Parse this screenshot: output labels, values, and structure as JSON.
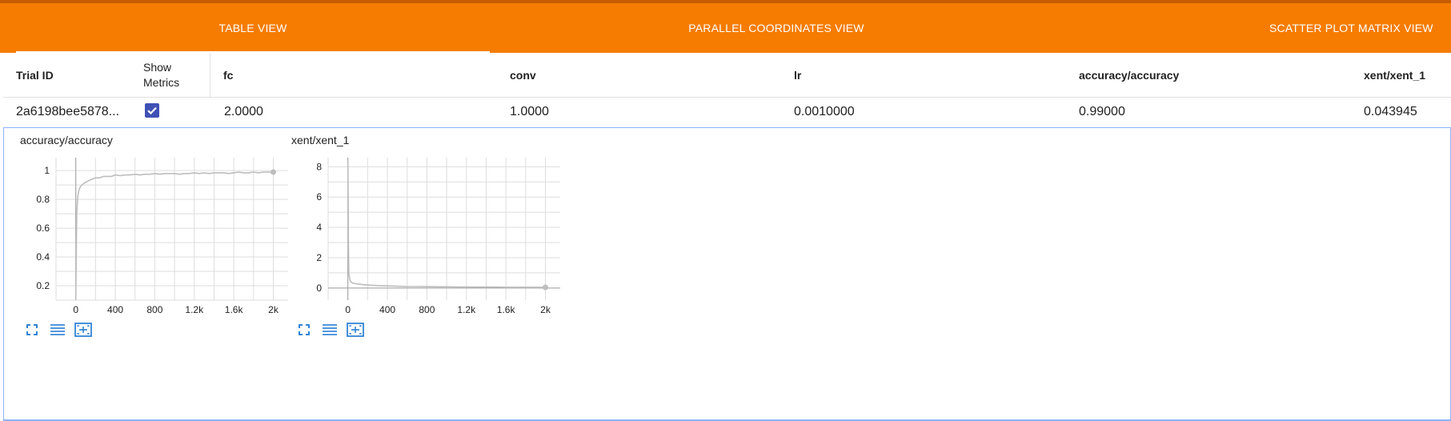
{
  "tabs": [
    {
      "label": "TABLE VIEW",
      "active": true
    },
    {
      "label": "PARALLEL COORDINATES VIEW",
      "active": false
    },
    {
      "label": "SCATTER PLOT MATRIX VIEW",
      "active": false
    }
  ],
  "table": {
    "headers": {
      "trial_id": "Trial ID",
      "show_metrics_1": "Show",
      "show_metrics_2": "Metrics",
      "fc": "fc",
      "conv": "conv",
      "lr": "lr",
      "accuracy": "accuracy/accuracy",
      "xent": "xent/xent_1"
    },
    "row": {
      "trial_id": "2a6198bee5878...",
      "show_metrics": true,
      "fc": "2.0000",
      "conv": "1.0000",
      "lr": "0.0010000",
      "accuracy": "0.99000",
      "xent": "0.043945"
    }
  },
  "accent_color": "#f57c00",
  "checkbox_color": "#3f51b5",
  "tool_icons": [
    "fullscreen-icon",
    "toggle-y-log-icon",
    "fit-domain-icon"
  ],
  "chart_data": [
    {
      "type": "line",
      "title": "accuracy/accuracy",
      "xlim": [
        -200,
        2150
      ],
      "ylim": [
        0.1,
        1.09
      ],
      "x_ticks": [
        "0",
        "400",
        "800",
        "1.2k",
        "1.6k",
        "2k"
      ],
      "x_tick_values": [
        0,
        400,
        800,
        1200,
        1600,
        2000
      ],
      "y_ticks": [
        "0.2",
        "0.4",
        "0.6",
        "0.8",
        "1"
      ],
      "y_tick_values": [
        0.2,
        0.4,
        0.6,
        0.8,
        1.0
      ],
      "series": [
        {
          "x": [
            0,
            5,
            10,
            20,
            30,
            40,
            60,
            80,
            100,
            130,
            160,
            200,
            240,
            280,
            320,
            360,
            400,
            450,
            500,
            550,
            600,
            650,
            700,
            750,
            800,
            850,
            900,
            950,
            1000,
            1050,
            1100,
            1150,
            1200,
            1250,
            1300,
            1350,
            1400,
            1450,
            1500,
            1550,
            1600,
            1650,
            1700,
            1750,
            1800,
            1850,
            1900,
            1950,
            2000
          ],
          "y": [
            0.1,
            0.45,
            0.7,
            0.82,
            0.86,
            0.88,
            0.9,
            0.91,
            0.92,
            0.93,
            0.94,
            0.95,
            0.95,
            0.96,
            0.96,
            0.96,
            0.97,
            0.965,
            0.97,
            0.97,
            0.975,
            0.97,
            0.975,
            0.975,
            0.98,
            0.975,
            0.98,
            0.98,
            0.98,
            0.975,
            0.98,
            0.98,
            0.985,
            0.98,
            0.985,
            0.98,
            0.985,
            0.985,
            0.985,
            0.98,
            0.985,
            0.99,
            0.985,
            0.985,
            0.99,
            0.985,
            0.99,
            0.99,
            0.99
          ]
        }
      ]
    },
    {
      "type": "line",
      "title": "xent/xent_1",
      "xlim": [
        -200,
        2150
      ],
      "ylim": [
        -0.8,
        8.6
      ],
      "x_ticks": [
        "0",
        "400",
        "800",
        "1.2k",
        "1.6k",
        "2k"
      ],
      "x_tick_values": [
        0,
        400,
        800,
        1200,
        1600,
        2000
      ],
      "y_ticks": [
        "0",
        "2",
        "4",
        "6",
        "8"
      ],
      "y_tick_values": [
        0,
        2,
        4,
        6,
        8
      ],
      "series": [
        {
          "x": [
            0,
            5,
            10,
            20,
            30,
            50,
            80,
            120,
            160,
            200,
            250,
            300,
            400,
            500,
            600,
            700,
            800,
            900,
            1000,
            1100,
            1200,
            1300,
            1400,
            1500,
            1600,
            1700,
            1800,
            1900,
            2000
          ],
          "y": [
            8.4,
            3.0,
            1.0,
            0.55,
            0.4,
            0.32,
            0.28,
            0.25,
            0.22,
            0.2,
            0.18,
            0.16,
            0.14,
            0.12,
            0.1,
            0.1,
            0.09,
            0.08,
            0.08,
            0.07,
            0.07,
            0.06,
            0.06,
            0.06,
            0.05,
            0.05,
            0.05,
            0.05,
            0.044
          ]
        }
      ]
    }
  ]
}
